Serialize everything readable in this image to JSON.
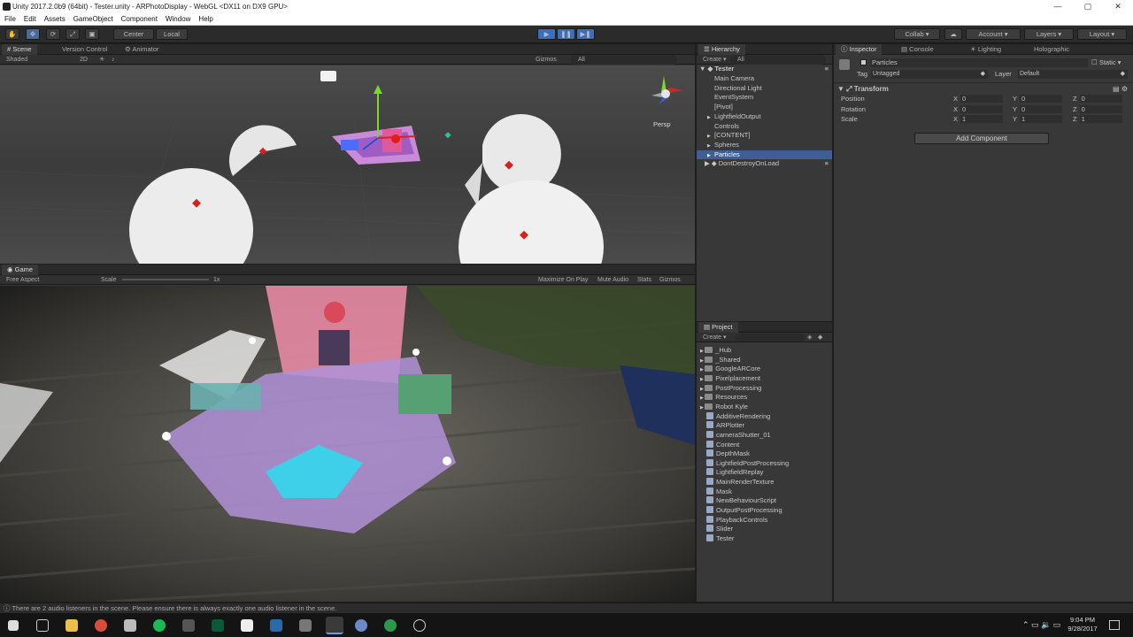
{
  "window": {
    "title": "Unity 2017.2.0b9 (64bit) - Tester.unity - ARPhotoDisplay - WebGL <DX11 on DX9 GPU>"
  },
  "menu": [
    "File",
    "Edit",
    "Assets",
    "GameObject",
    "Component",
    "Window",
    "Help"
  ],
  "toolbar": {
    "pivot_center": "Center",
    "pivot_local": "Local",
    "collab": "Collab",
    "account": "Account",
    "layers": "Layers",
    "layout": "Layout"
  },
  "scene": {
    "tabs": [
      "Scene",
      "Version Control",
      "Animator"
    ],
    "shading": "Shaded",
    "mode_2d": "2D",
    "gizmos": "Gizmos",
    "search": "All",
    "persp": "Persp"
  },
  "game": {
    "tab": "Game",
    "aspect": "Free Aspect",
    "scale_label": "Scale",
    "scale_value": "1x",
    "options": [
      "Maximize On Play",
      "Mute Audio",
      "Stats",
      "Gizmos"
    ]
  },
  "hierarchy": {
    "tab": "Hierarchy",
    "create": "Create",
    "search": "All",
    "scene_name": "Tester",
    "items": [
      {
        "label": "Main Camera",
        "arrow": ""
      },
      {
        "label": "Directional Light",
        "arrow": ""
      },
      {
        "label": "EventSystem",
        "arrow": ""
      },
      {
        "label": "[Pivot]",
        "arrow": ""
      },
      {
        "label": "LightfieldOutput",
        "arrow": "▶"
      },
      {
        "label": "Controls",
        "arrow": ""
      },
      {
        "label": "[CONTENT]",
        "arrow": "▶"
      },
      {
        "label": "Spheres",
        "arrow": "▶"
      },
      {
        "label": "Particles",
        "arrow": "▶"
      }
    ],
    "ddol": "DontDestroyOnLoad"
  },
  "project": {
    "tab": "Project",
    "create": "Create",
    "folders": [
      "_Hub",
      "_Shared",
      "GoogleARCore",
      "Pixelplacement",
      "PostProcessing",
      "Resources",
      "Robot Kyle"
    ],
    "assets": [
      "AdditiveRendering",
      "ARPlotter",
      "cameraShutter_01",
      "Content",
      "DepthMask",
      "LightfieldPostProcessing",
      "LightfieldReplay",
      "MainRenderTexture",
      "Mask",
      "NewBehaviourScript",
      "OutputPostProcessing",
      "PlaybackControls",
      "Slider",
      "Tester"
    ]
  },
  "inspector": {
    "tabs": [
      "Inspector",
      "Console",
      "Lighting",
      "Holographic"
    ],
    "object_name": "Particles",
    "static": "Static",
    "tag_label": "Tag",
    "tag": "Untagged",
    "layer_label": "Layer",
    "layer": "Default",
    "component": "Transform",
    "rows": [
      {
        "label": "Position",
        "x": "0",
        "y": "0",
        "z": "0"
      },
      {
        "label": "Rotation",
        "x": "0",
        "y": "0",
        "z": "0"
      },
      {
        "label": "Scale",
        "x": "1",
        "y": "1",
        "z": "1"
      }
    ],
    "add_component": "Add Component"
  },
  "status": {
    "message": "There are 2 audio listeners in the scene. Please ensure there is always exactly one audio listener in the scene."
  },
  "taskbar": {
    "time": "9:04 PM",
    "date": "9/28/2017"
  }
}
